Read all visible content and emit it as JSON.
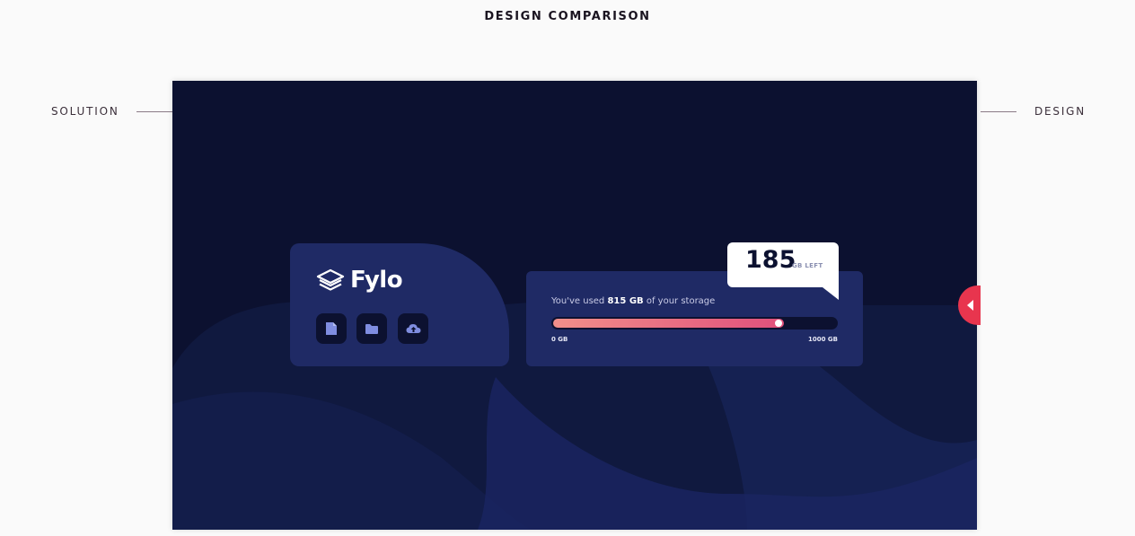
{
  "header": {
    "title": "DESIGN COMPARISON"
  },
  "labels": {
    "solution": "SOLUTION",
    "design": "DESIGN"
  },
  "fylo": {
    "logo_text": "Fylo",
    "icons": [
      "document-icon",
      "folder-icon",
      "upload-icon"
    ]
  },
  "storage": {
    "usage_prefix": "You've used ",
    "used_amount": "815 GB",
    "usage_suffix": " of your storage",
    "used_fraction": 0.815,
    "min_label": "0 GB",
    "max_label": "1000 GB",
    "remaining_value": "185",
    "remaining_unit": "GB LEFT"
  },
  "colors": {
    "background": "#0c1130",
    "card": "#1f2a65",
    "gradient_start": "#f18f8a",
    "gradient_end": "#e0507c",
    "toggle_accent": "#e8354e"
  },
  "controls": {
    "toggle_icon": "chevron-left-icon"
  }
}
